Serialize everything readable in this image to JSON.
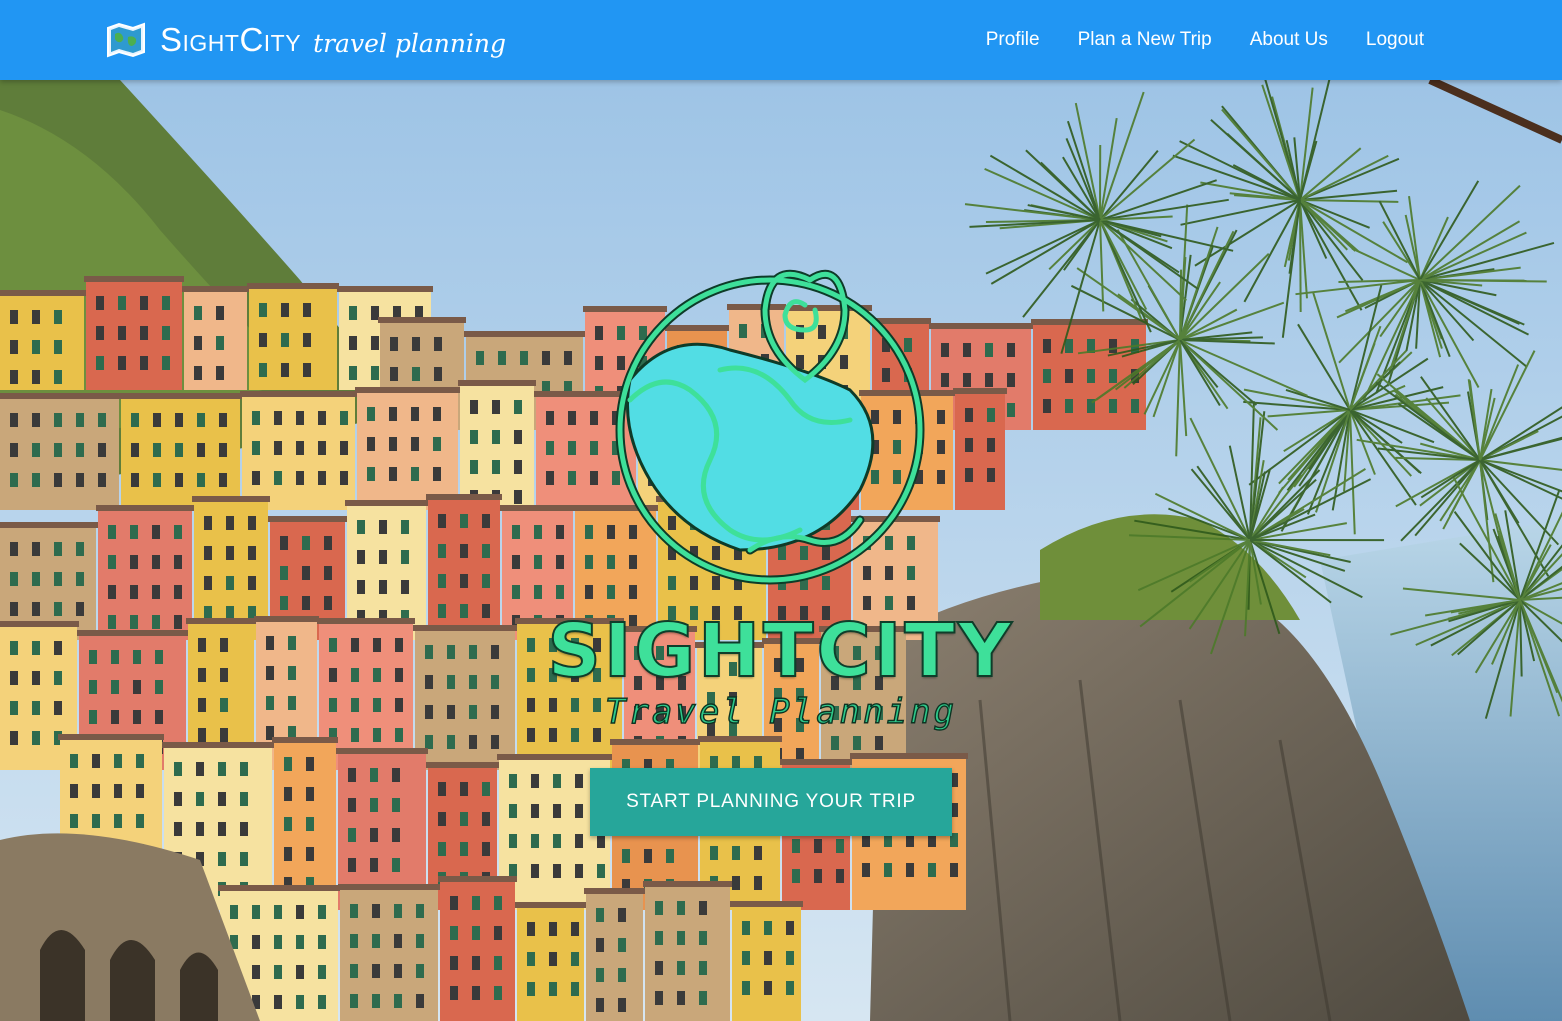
{
  "navbar": {
    "brand_name": "SightCity",
    "brand_subtitle": "travel planning",
    "brand_icon": "map-icon",
    "links": [
      {
        "label": "Profile"
      },
      {
        "label": "Plan a New Trip"
      },
      {
        "label": "About Us"
      },
      {
        "label": "Logout"
      }
    ],
    "background_color": "#2196f3"
  },
  "hero": {
    "background": "photo of colorful cliffside village by the sea with pine branches",
    "logo_icon": "globe-location-pin-logo",
    "title": "SIGHTCITY",
    "subtitle": "Travel Planning",
    "cta_label": "START PLANNING YOUR TRIP",
    "cta_color": "#26a69a",
    "logo_color": "#3ee09a"
  }
}
